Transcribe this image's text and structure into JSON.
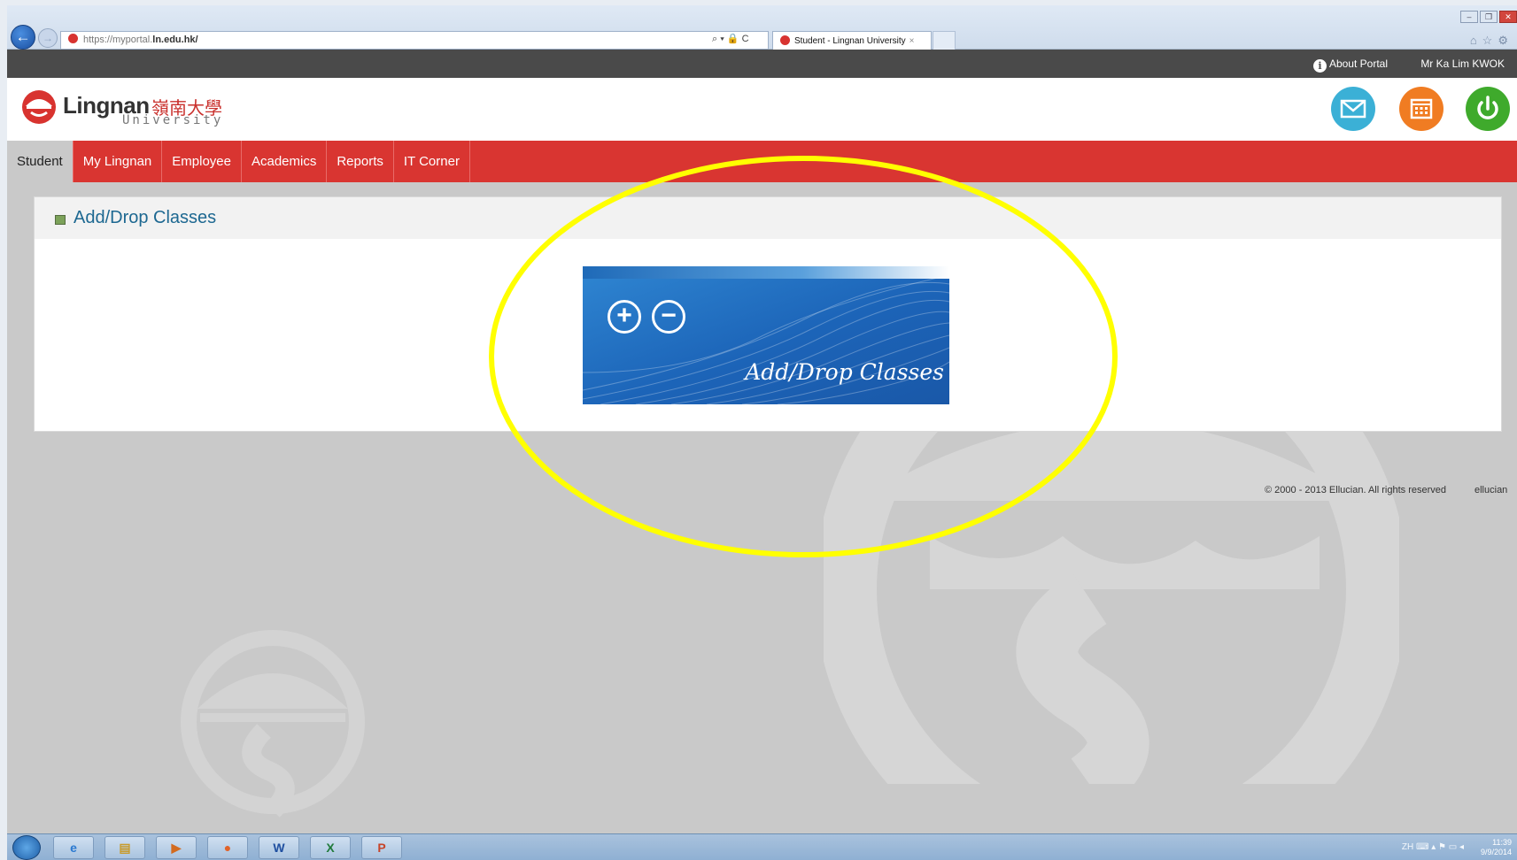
{
  "browser": {
    "url_prefix": "https://myportal.",
    "url_domain": "ln.edu.hk/",
    "addr_tools": "⌕ ▾ 🔒 C",
    "tab_title": "Student - Lingnan University",
    "tab_close": "×"
  },
  "topbar": {
    "about_label": "About Portal",
    "user_name": "Mr Ka Lim KWOK"
  },
  "header": {
    "logo_en": "Lingnan",
    "logo_zh": "嶺南大學",
    "logo_univ": "University",
    "buttons": [
      "mail-icon",
      "calendar-icon",
      "power-icon"
    ]
  },
  "nav": {
    "items": [
      {
        "label": "Student",
        "active": true
      },
      {
        "label": "My Lingnan"
      },
      {
        "label": "Employee"
      },
      {
        "label": "Academics"
      },
      {
        "label": "Reports"
      },
      {
        "label": "IT Corner"
      }
    ]
  },
  "panel": {
    "title": "Add/Drop Classes",
    "banner_label": "Add/Drop Classes",
    "banner_plus": "+",
    "banner_minus": "−"
  },
  "footer": {
    "copyright": "© 2000 - 2013 Ellucian. All rights reserved",
    "brand": "ellucian"
  },
  "taskbar": {
    "apps": [
      "start-icon",
      "ie-icon",
      "explorer-icon",
      "media-player-icon",
      "firefox-icon",
      "word-icon",
      "excel-icon",
      "powerpoint-icon"
    ],
    "tray_lang": "ZH",
    "time": "11:39",
    "date": "9/9/2014"
  },
  "colors": {
    "nav_red": "#d93531",
    "highlight": "#ffff00",
    "banner_blue": "#1c64b8"
  }
}
